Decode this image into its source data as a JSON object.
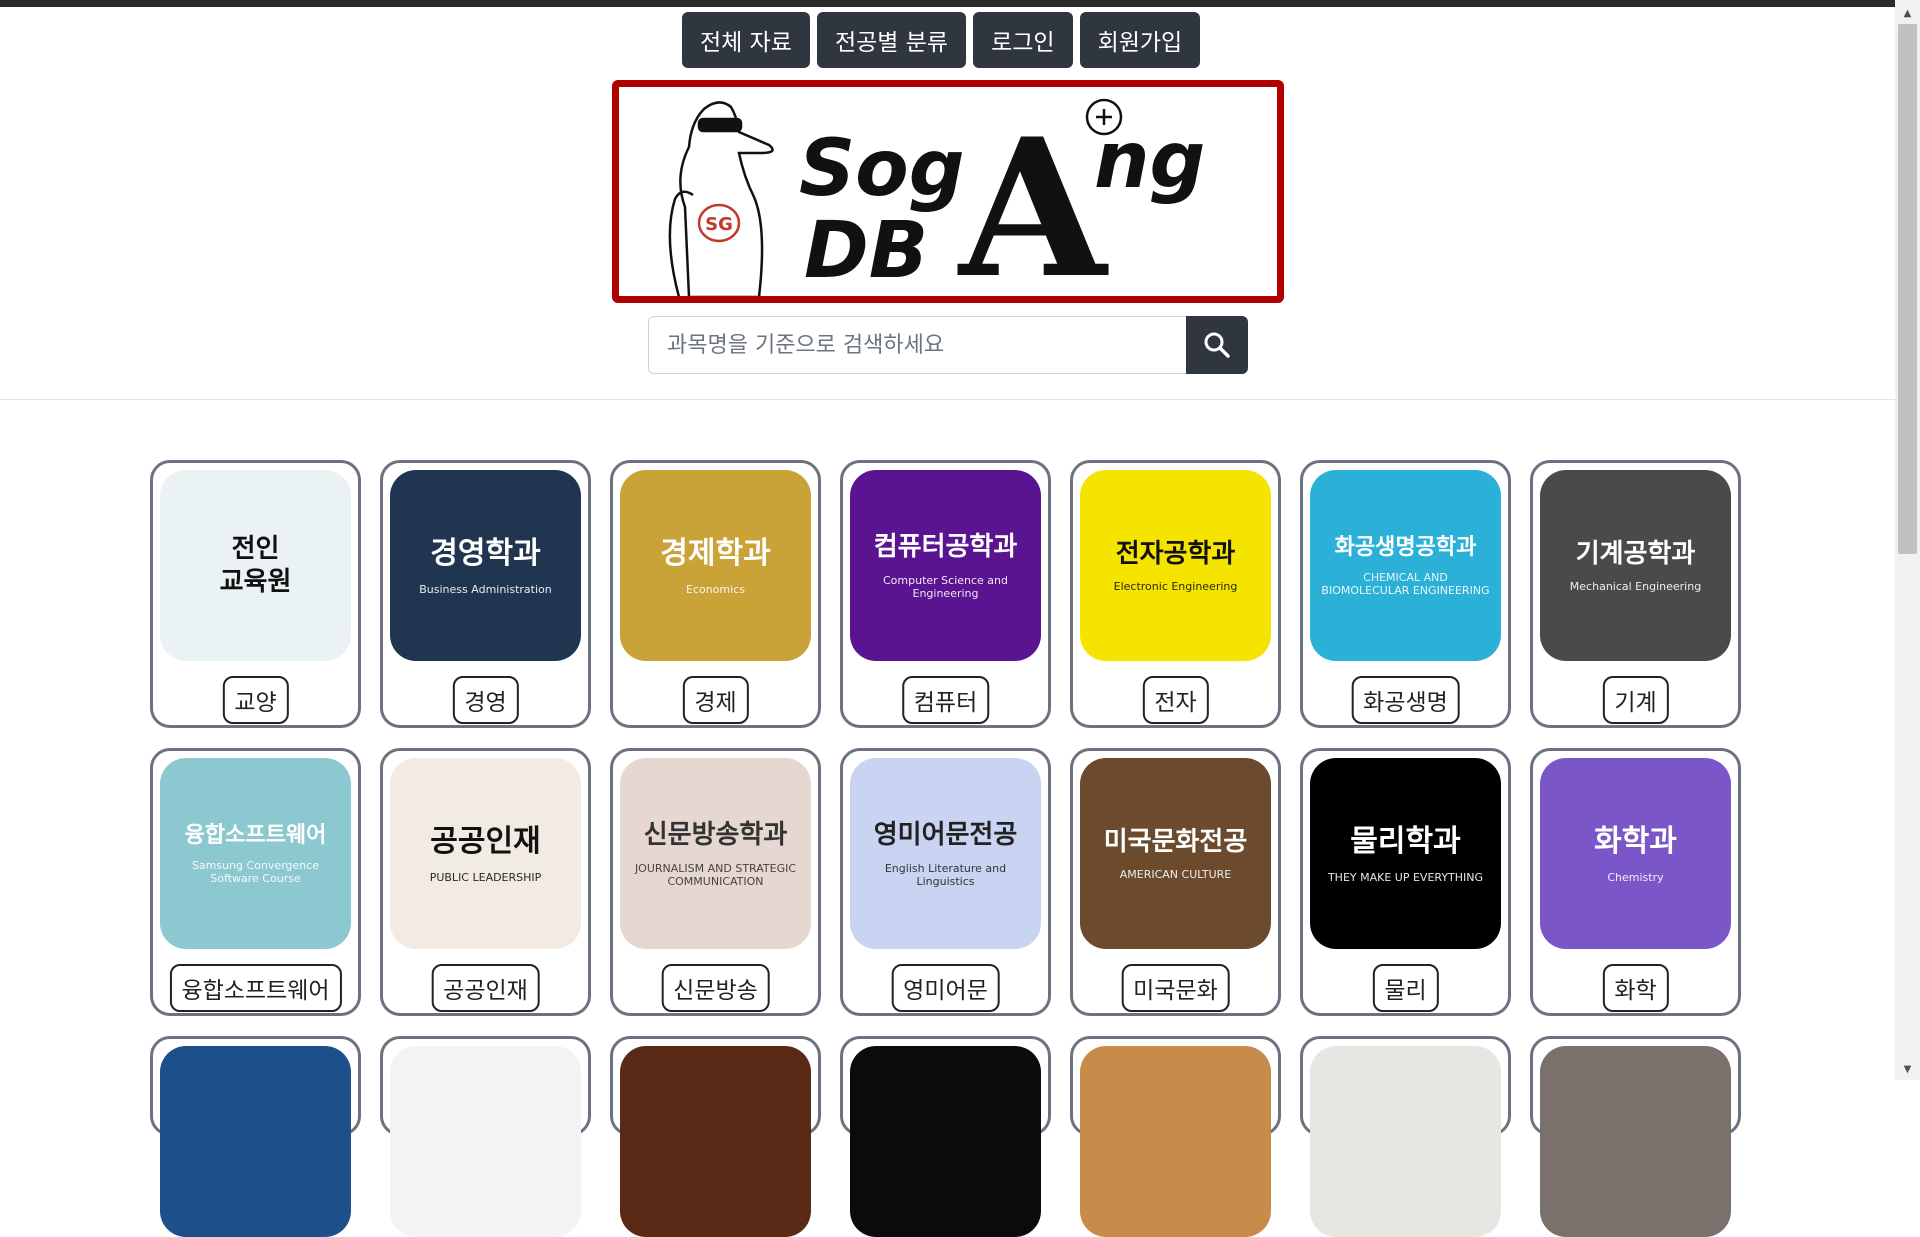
{
  "nav": [
    {
      "label": "전체 자료",
      "name": "nav-all-materials"
    },
    {
      "label": "전공별 분류",
      "name": "nav-by-major"
    },
    {
      "label": "로그인",
      "name": "nav-login"
    },
    {
      "label": "회원가입",
      "name": "nav-signup"
    }
  ],
  "logo": {
    "line1": "Sog",
    "letter": "A",
    "line1b": "ng",
    "line2": "DB",
    "badge": "SG"
  },
  "search": {
    "placeholder": "과목명을 기준으로 검색하세요"
  },
  "categories": [
    {
      "label": "교양",
      "thumb_text": "전인\n교육원",
      "bg": "#eaf2f4",
      "fg": "#111111"
    },
    {
      "label": "경영",
      "thumb_text": "경영학과",
      "sub": "Business Administration",
      "bg": "#1f3550",
      "fg": "#ffffff"
    },
    {
      "label": "경제",
      "thumb_text": "경제학과",
      "sub": "Economics",
      "bg": "#c9a238",
      "fg": "#ffffff"
    },
    {
      "label": "컴퓨터",
      "thumb_text": "컴퓨터공학과",
      "sub": "Computer Science and Engineering",
      "bg": "#5a1391",
      "fg": "#ffffff"
    },
    {
      "label": "전자",
      "thumb_text": "전자공학과",
      "sub": "Electronic Engineering",
      "bg": "#f5e400",
      "fg": "#111111"
    },
    {
      "label": "화공생명",
      "thumb_text": "화공생명공학과",
      "sub": "CHEMICAL AND BIOMOLECULAR ENGINEERING",
      "bg": "#2bb0d8",
      "fg": "#ffffff"
    },
    {
      "label": "기계",
      "thumb_text": "기계공학과",
      "sub": "Mechanical Engineering",
      "bg": "#4a4a4a",
      "fg": "#ffffff"
    },
    {
      "label": "융합소프트웨어",
      "thumb_text": "융합소프트웨어",
      "sub": "Samsung Convergence Software Course",
      "bg": "#8cc8cf",
      "fg": "#ffffff"
    },
    {
      "label": "공공인재",
      "thumb_text": "공공인재",
      "sub": "PUBLIC LEADERSHIP",
      "bg": "#f1ebe3",
      "fg": "#111111"
    },
    {
      "label": "신문방송",
      "thumb_text": "신문방송학과",
      "sub": "JOURNALISM AND STRATEGIC COMMUNICATION",
      "bg": "#e6d7d0",
      "fg": "#333333"
    },
    {
      "label": "영미어문",
      "thumb_text": "영미어문전공",
      "sub": "English Literature and Linguistics",
      "bg": "#c9d3f2",
      "fg": "#222222"
    },
    {
      "label": "미국문화",
      "thumb_text": "미국문화전공",
      "sub": "AMERICAN CULTURE",
      "bg": "#6b4a2e",
      "fg": "#ffffff"
    },
    {
      "label": "물리",
      "thumb_text": "물리학과",
      "sub": "THEY MAKE UP EVERYTHING",
      "bg": "#000000",
      "fg": "#ffffff"
    },
    {
      "label": "화학",
      "thumb_text": "화학과",
      "sub": "Chemistry",
      "bg": "#7a56c8",
      "fg": "#ffffff"
    }
  ],
  "partial_row": [
    {
      "bg": "#1d4f8a"
    },
    {
      "bg": "#f3f3f3"
    },
    {
      "bg": "#5a2a16"
    },
    {
      "bg": "#0b0b0b"
    },
    {
      "bg": "#c88c4a"
    },
    {
      "bg": "#e8e6e2"
    },
    {
      "bg": "#7a716c"
    }
  ]
}
